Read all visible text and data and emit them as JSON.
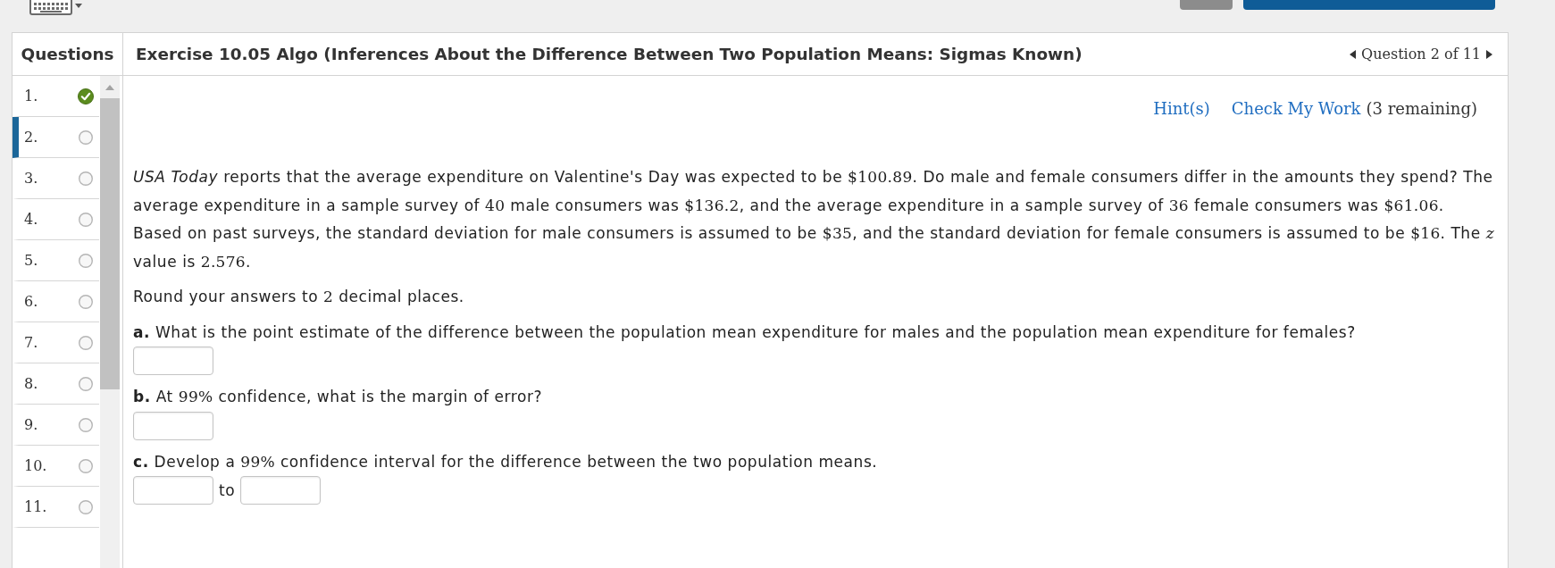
{
  "sidebar": {
    "title": "Questions",
    "items": [
      {
        "label": "1.",
        "answered": true,
        "selected": false
      },
      {
        "label": "2.",
        "answered": false,
        "selected": true
      },
      {
        "label": "3.",
        "answered": false,
        "selected": false
      },
      {
        "label": "4.",
        "answered": false,
        "selected": false
      },
      {
        "label": "5.",
        "answered": false,
        "selected": false
      },
      {
        "label": "6.",
        "answered": false,
        "selected": false
      },
      {
        "label": "7.",
        "answered": false,
        "selected": false
      },
      {
        "label": "8.",
        "answered": false,
        "selected": false
      },
      {
        "label": "9.",
        "answered": false,
        "selected": false
      },
      {
        "label": "10.",
        "answered": false,
        "selected": false
      },
      {
        "label": "11.",
        "answered": false,
        "selected": false
      }
    ]
  },
  "header": {
    "title": "Exercise 10.05 Algo (Inferences About the Difference Between Two Population Means: Sigmas Known)",
    "pager": "Question 2 of 11"
  },
  "links": [
    {
      "label": "Hint(s)"
    },
    {
      "label": "Check My Work",
      "note": "(3 remaining)"
    }
  ],
  "problem": {
    "intro": [
      {
        "kind": "text",
        "text": "*USA Today* reports that the average expenditure on Valentine's Day was expected to be "
      },
      {
        "kind": "math",
        "text": "$100.89"
      },
      {
        "kind": "text",
        "text": ". Do male and female consumers differ in the amounts they spend? The average expenditure in a sample survey of "
      },
      {
        "kind": "math",
        "text": "40"
      },
      {
        "kind": "text",
        "text": " male consumers was "
      },
      {
        "kind": "math",
        "text": "$136.2"
      },
      {
        "kind": "text",
        "text": ", and the average expenditure in a sample survey of "
      },
      {
        "kind": "math",
        "text": "36"
      },
      {
        "kind": "text",
        "text": " female consumers was "
      },
      {
        "kind": "math",
        "text": "$61.06"
      },
      {
        "kind": "text",
        "text": ". Based on past surveys, the standard deviation for male consumers is assumed to be "
      },
      {
        "kind": "math",
        "text": "$35"
      },
      {
        "kind": "text",
        "text": ", and the standard deviation for female consumers is assumed to be "
      },
      {
        "kind": "math",
        "text": "$16"
      },
      {
        "kind": "text",
        "text": ". The "
      },
      {
        "kind": "math",
        "text": "*z*"
      },
      {
        "kind": "text",
        "text": " value is "
      },
      {
        "kind": "math",
        "text": "2.576"
      },
      {
        "kind": "text",
        "text": "."
      }
    ],
    "instruction": [
      {
        "kind": "text",
        "text": "Round your answers to "
      },
      {
        "kind": "math",
        "text": "2"
      },
      {
        "kind": "text",
        "text": " decimal places."
      }
    ],
    "parts": [
      {
        "label": "a.",
        "kind": "single",
        "prompt": [
          {
            "kind": "text",
            "text": "What is the point estimate of the difference between the population mean expenditure for males and the population mean expenditure for females?"
          }
        ]
      },
      {
        "label": "b.",
        "kind": "single",
        "prompt": [
          {
            "kind": "text",
            "text": "At "
          },
          {
            "kind": "math",
            "text": "99%"
          },
          {
            "kind": "text",
            "text": " confidence, what is the margin of error?"
          }
        ]
      },
      {
        "label": "c.",
        "kind": "interval",
        "separator": "to",
        "prompt": [
          {
            "kind": "text",
            "text": "Develop a "
          },
          {
            "kind": "math",
            "text": "99%"
          },
          {
            "kind": "text",
            "text": " confidence interval for the difference between the two population means."
          }
        ]
      }
    ]
  }
}
